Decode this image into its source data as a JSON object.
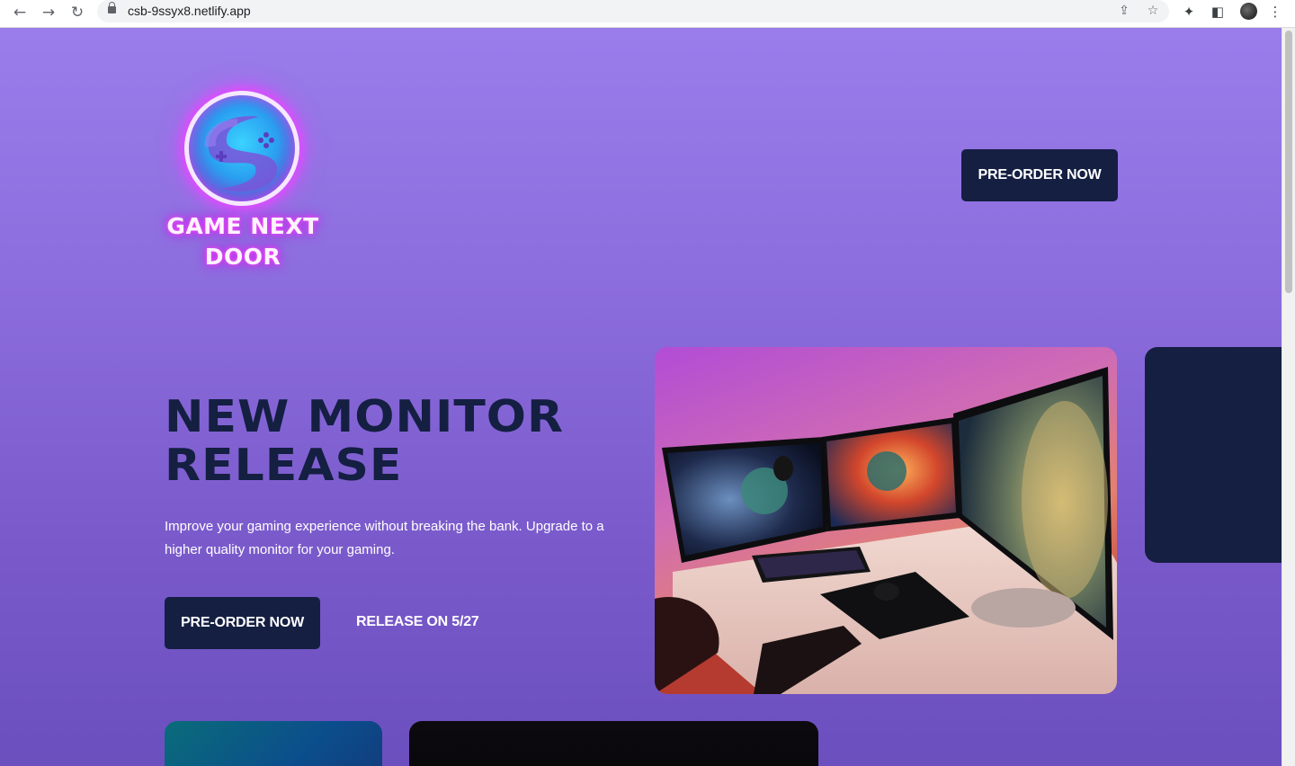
{
  "browser": {
    "url": "csb-9ssyx8.netlify.app",
    "icons": [
      "back-arrow-icon",
      "forward-arrow-icon",
      "reload-icon",
      "lock-icon",
      "share-icon",
      "star-icon",
      "extensions-icon",
      "side-panel-icon",
      "profile-avatar",
      "menu-kebab-icon"
    ]
  },
  "header": {
    "logo_text_line1": "GAME NEXT",
    "logo_text_line2": "DOOR",
    "cta_label": "PRE-ORDER NOW"
  },
  "hero": {
    "headline_line1": "NEW MONITOR",
    "headline_line2": "RELEASE",
    "description": "Improve your gaming experience without breaking the bank. Upgrade to a higher quality monitor for your gaming.",
    "primary_cta": "PRE-ORDER NOW",
    "secondary_cta": "RELEASE ON 5/27"
  },
  "colors": {
    "background_top": "#9a7ceb",
    "background_bottom": "#6b4fbe",
    "navy": "#141f42",
    "neon_pink": "#e04bff",
    "white": "#ffffff"
  }
}
